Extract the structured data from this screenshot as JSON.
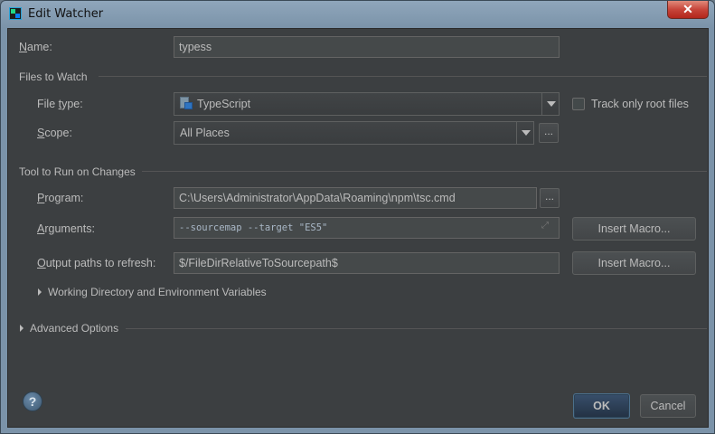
{
  "window": {
    "title": "Edit Watcher",
    "close_glyph": "✕"
  },
  "name": {
    "label_key": "N",
    "label_rest": "ame:",
    "value": "typess"
  },
  "files_to_watch": {
    "section_title": "Files to Watch",
    "file_type": {
      "label_pre": "File ",
      "label_key": "t",
      "label_rest": "ype:",
      "value": "TypeScript",
      "icon": "typescript-file-icon"
    },
    "track_only_root": {
      "label": "Track only root files",
      "checked": false
    },
    "scope": {
      "label_key": "S",
      "label_rest": "cope:",
      "value": "All Places",
      "browse_label": "..."
    }
  },
  "tool_to_run": {
    "section_title": "Tool to Run on Changes",
    "program": {
      "label_key": "P",
      "label_rest": "rogram:",
      "value": "C:\\Users\\Administrator\\AppData\\Roaming\\npm\\tsc.cmd",
      "browse_label": "..."
    },
    "arguments": {
      "label_key": "A",
      "label_rest": "rguments:",
      "value": "--sourcemap --target \"ES5\"",
      "insert_macro_label": "Insert Macro..."
    },
    "output_paths": {
      "label_key": "O",
      "label_rest": "utput paths to refresh:",
      "value": "$/FileDirRelativeToSourcepath$",
      "insert_macro_label": "Insert Macro..."
    },
    "working_dir_label": "Working Directory and Environment Variables"
  },
  "advanced_options_label": "Advanced Options",
  "footer": {
    "help_glyph": "?",
    "ok_label": "OK",
    "cancel_label": "Cancel"
  },
  "colors": {
    "panel_bg": "#3c3f41",
    "text": "#bbbbbb",
    "field_bg": "#45494a",
    "default_button": "#365880"
  }
}
